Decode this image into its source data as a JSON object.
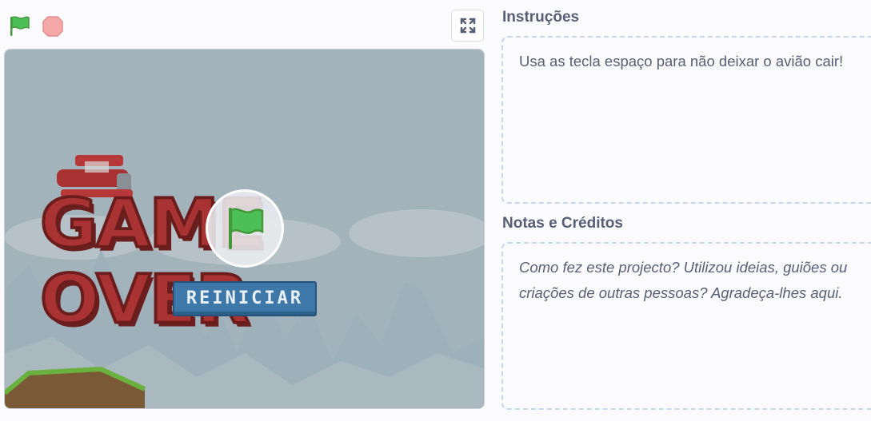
{
  "controls": {
    "green_flag_icon": "green-flag-icon",
    "stop_icon": "stop-sign-icon",
    "fullscreen_icon": "fullscreen-icon"
  },
  "stage": {
    "title_text": "GAME OVER",
    "restart_label": "REINICIAR",
    "play_overlay_icon": "green-flag-icon"
  },
  "instructions": {
    "title": "Instruções",
    "text": "Usa as tecla espaço para não deixar o avião cair!"
  },
  "notes": {
    "title": "Notas e Créditos",
    "placeholder_line1": "Como fez este projecto? Utilizou ideias, guiões ou",
    "placeholder_line2": "criações de outras pessoas? Agradeça-lhes aqui."
  },
  "colors": {
    "flag_green": "#4cbf56",
    "stop_red": "#ec9c9c",
    "title_red": "#a93232",
    "button_blue": "#3d78a8",
    "text_gray": "#575e75"
  }
}
